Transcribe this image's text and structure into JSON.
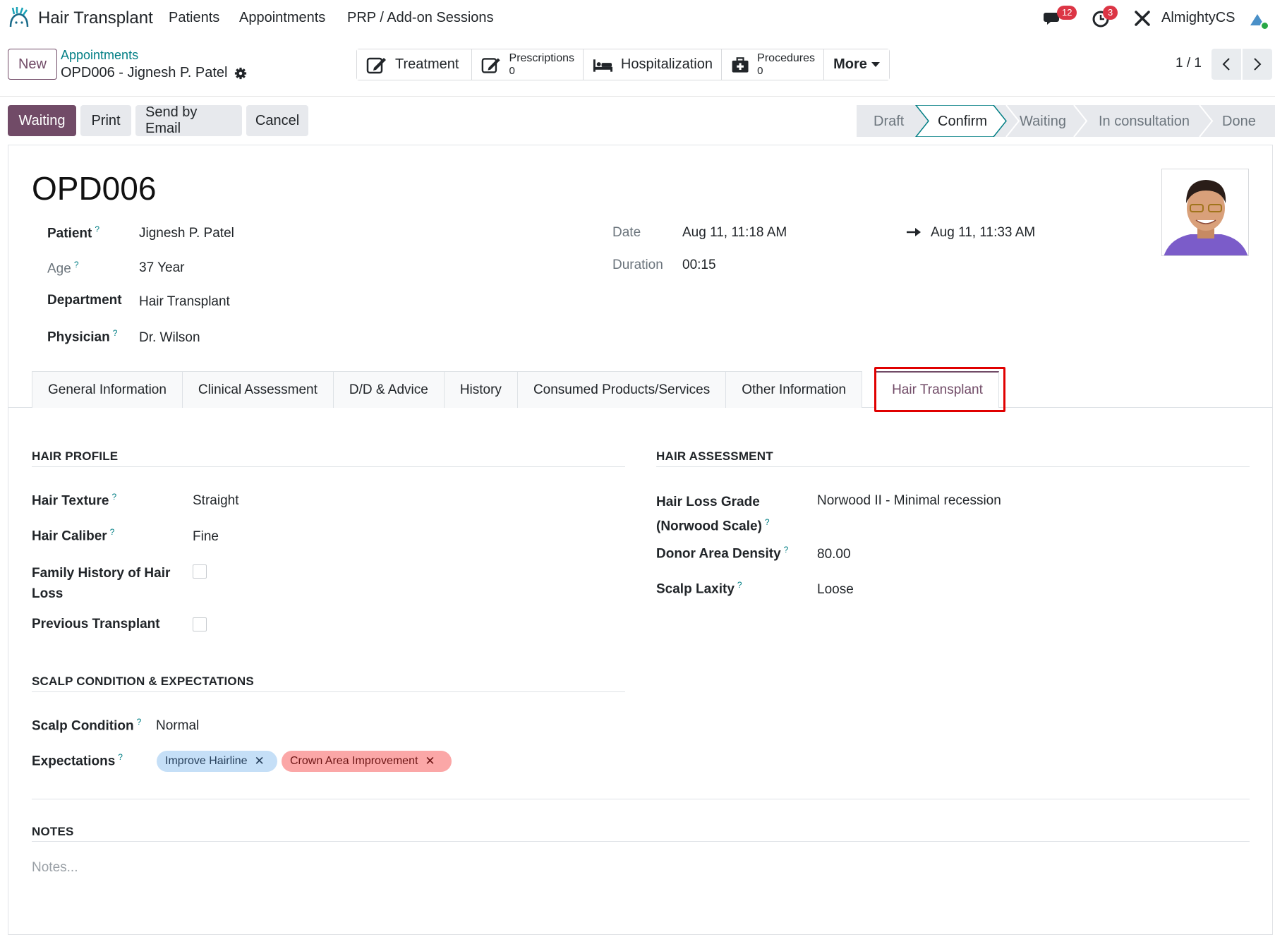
{
  "app": {
    "name": "Hair Transplant",
    "menu": [
      "Patients",
      "Appointments",
      "PRP / Add-on Sessions"
    ],
    "messages_count": "12",
    "activities_count": "3",
    "user": "AlmightyCS"
  },
  "control": {
    "new_label": "New",
    "breadcrumb_parent": "Appointments",
    "breadcrumb_current": "OPD006 - Jignesh P. Patel",
    "smart_buttons": {
      "treatment": "Treatment",
      "prescriptions": "Prescriptions",
      "prescriptions_count": "0",
      "hospitalization": "Hospitalization",
      "procedures": "Procedures",
      "procedures_count": "0",
      "more": "More"
    },
    "pager": "1 / 1"
  },
  "actions": {
    "waiting": "Waiting",
    "print": "Print",
    "send_email": "Send by Email",
    "cancel": "Cancel"
  },
  "stages": [
    "Draft",
    "Confirm",
    "Waiting",
    "In consultation",
    "Done"
  ],
  "current_stage": "Confirm",
  "record": {
    "name": "OPD006",
    "patient_label": "Patient",
    "patient": "Jignesh P. Patel",
    "age_label": "Age",
    "age": "37 Year",
    "department_label": "Department",
    "department": "Hair Transplant",
    "physician_label": "Physician",
    "physician": "Dr. Wilson",
    "date_label": "Date",
    "date_start": "Aug 11, 11:18 AM",
    "date_end": "Aug 11, 11:33 AM",
    "duration_label": "Duration",
    "duration": "00:15"
  },
  "tabs": [
    "General Information",
    "Clinical Assessment",
    "D/D & Advice",
    "History",
    "Consumed Products/Services",
    "Other Information",
    "Hair Transplant"
  ],
  "active_tab": "Hair Transplant",
  "hair_profile": {
    "title": "HAIR PROFILE",
    "texture_label": "Hair Texture",
    "texture": "Straight",
    "caliber_label": "Hair Caliber",
    "caliber": "Fine",
    "family_history_label_1": "Family History of Hair",
    "family_history_label_2": "Loss",
    "previous_transplant_label": "Previous Transplant"
  },
  "hair_assessment": {
    "title": "HAIR ASSESSMENT",
    "grade_label_1": "Hair Loss Grade",
    "grade_label_2": "(Norwood Scale)",
    "grade": "Norwood II - Minimal recession",
    "density_label": "Donor Area Density",
    "density": "80.00",
    "laxity_label": "Scalp Laxity",
    "laxity": "Loose"
  },
  "scalp": {
    "title": "SCALP CONDITION & EXPECTATIONS",
    "condition_label": "Scalp Condition",
    "condition": "Normal",
    "expectations_label": "Expectations",
    "tags": [
      "Improve Hairline",
      "Crown Area Improvement"
    ]
  },
  "notes": {
    "title": "NOTES",
    "placeholder": "Notes..."
  },
  "help_mark": "?",
  "tag_remove": "✕",
  "colors": {
    "primary": "#714b67",
    "link": "#017e84",
    "badge": "#dc3545",
    "highlight": "#e00000"
  }
}
